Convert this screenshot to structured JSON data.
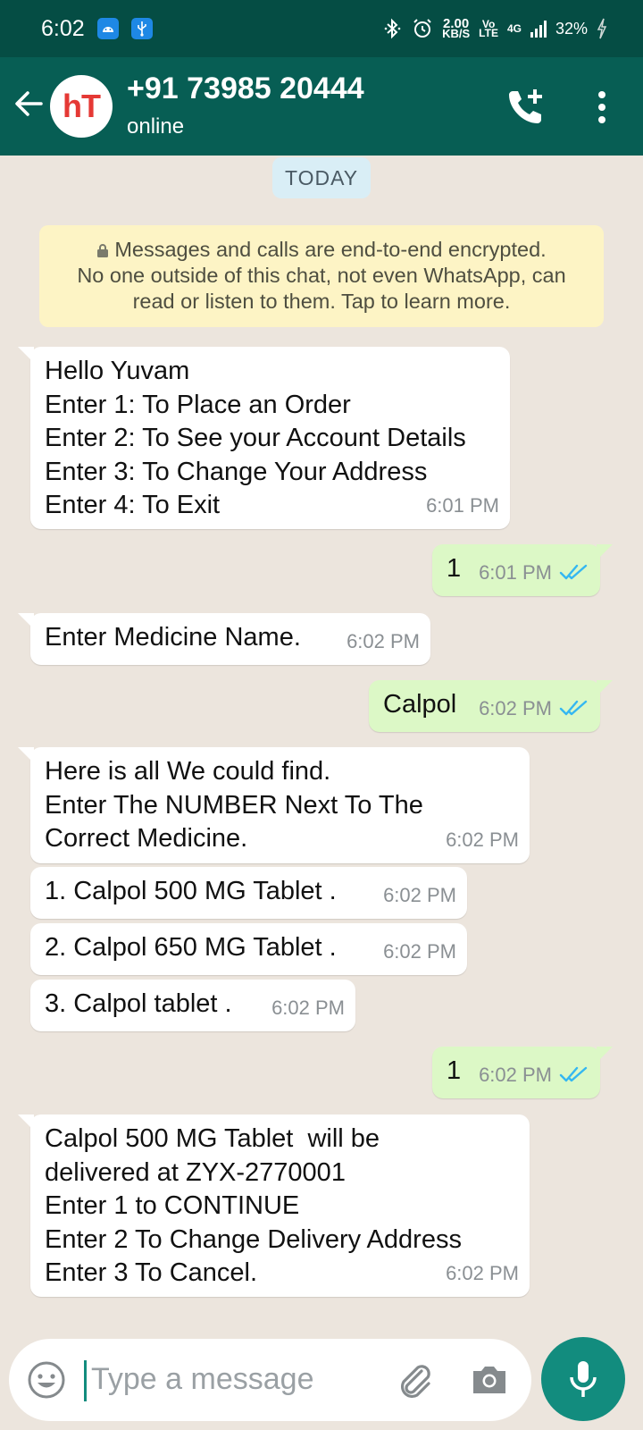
{
  "status_bar": {
    "time": "6:02",
    "speed_value": "2.00",
    "speed_unit": "KB/S",
    "volte_top": "Vo",
    "volte_bottom": "LTE",
    "network": "4G",
    "battery": "32%"
  },
  "header": {
    "avatar_text_h": "h",
    "avatar_text_t": "T",
    "contact_name": "+91 73985 20444",
    "contact_status": "online"
  },
  "chat": {
    "date_chip": "TODAY",
    "encryption_notice": [
      "Messages and calls are end-to-end encrypted.",
      "No one outside of this chat, not even WhatsApp, can",
      "read or listen to them. Tap to learn more."
    ],
    "messages": [
      {
        "direction": "in",
        "lines": [
          "Hello Yuvam",
          "Enter 1: To Place an Order",
          "Enter 2: To See your Account Details",
          "Enter 3: To Change Your Address",
          "Enter 4: To Exit"
        ],
        "time": "6:01 PM"
      },
      {
        "direction": "out",
        "lines": [
          "1"
        ],
        "time": "6:01 PM",
        "status": "read"
      },
      {
        "direction": "in",
        "lines": [
          "Enter Medicine Name."
        ],
        "time": "6:02 PM"
      },
      {
        "direction": "out",
        "lines": [
          "Calpol"
        ],
        "time": "6:02 PM",
        "status": "read"
      },
      {
        "direction": "in",
        "lines": [
          "Here is all We could find.",
          "Enter The NUMBER Next To The",
          "Correct Medicine."
        ],
        "time": "6:02 PM"
      },
      {
        "direction": "in",
        "lines": [
          "1. Calpol 500 MG Tablet ."
        ],
        "time": "6:02 PM"
      },
      {
        "direction": "in",
        "lines": [
          "2. Calpol 650 MG Tablet ."
        ],
        "time": "6:02 PM"
      },
      {
        "direction": "in",
        "lines": [
          "3. Calpol tablet ."
        ],
        "time": "6:02 PM"
      },
      {
        "direction": "out",
        "lines": [
          "1"
        ],
        "time": "6:02 PM",
        "status": "read"
      },
      {
        "direction": "in",
        "lines": [
          "Calpol 500 MG Tablet  will be",
          "delivered at ZYX-2770001",
          "Enter 1 to CONTINUE",
          "Enter 2 To Change Delivery Address",
          "Enter 3 To Cancel."
        ],
        "time": "6:02 PM"
      }
    ]
  },
  "composer": {
    "placeholder": "Type a message"
  },
  "colors": {
    "status_bar": "#054d44",
    "app_bar": "#075e54",
    "chat_bg": "#ece5dd",
    "incoming_bubble": "#ffffff",
    "outgoing_bubble": "#dcf8c6",
    "notice_bg": "#fdf4c5",
    "date_chip_bg": "#d9eef6",
    "read_ticks": "#34b7f1",
    "mic_button": "#128c7e"
  },
  "icons": {
    "back": "arrow-left-icon",
    "add_call": "phone-plus-icon",
    "menu": "more-vert-icon",
    "emoji": "smiley-icon",
    "attach": "paperclip-icon",
    "camera": "camera-icon",
    "mic": "mic-icon",
    "lock": "lock-icon",
    "read_receipt": "double-check-icon"
  }
}
